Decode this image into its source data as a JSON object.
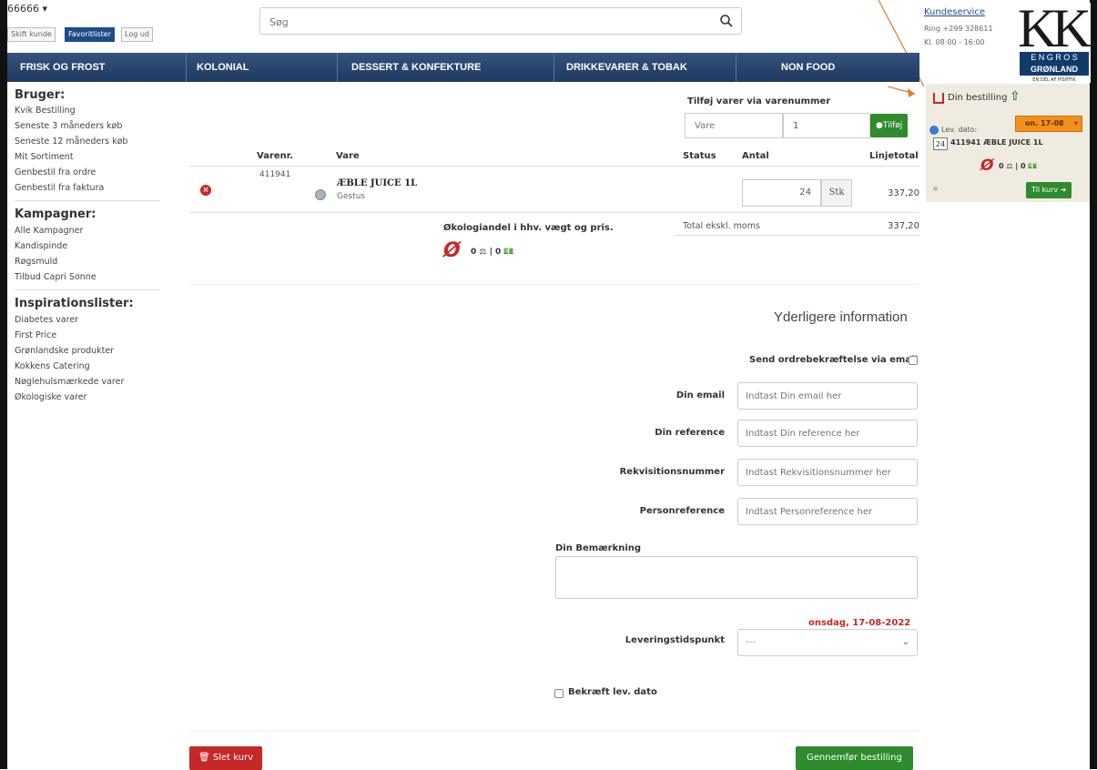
{
  "header": {
    "account": "66666 ▾",
    "btn_shift": "Skift kunde",
    "btn_fav": "Favoritlister",
    "btn_logout": "Log ud",
    "search_placeholder": "Søg",
    "kundeservice": "Kundeservice",
    "phone": "Ring +299 328611",
    "hours": "Kl. 08:00 - 16:00"
  },
  "logo": {
    "kk": "KK",
    "line1": "E N G R O S",
    "line2": "GRØNLAND",
    "sub": "EN DEL AF PISIFFIK"
  },
  "nav": [
    "FRISK OG FROST",
    "KOLONIAL",
    "DESSERT & KONFEKTURE",
    "DRIKKEVARER & TOBAK",
    "NON FOOD"
  ],
  "sidebar": {
    "bruger_title": "Bruger:",
    "bruger": [
      "Kvik Bestilling",
      "Seneste 3 måneders køb",
      "Seneste 12 måneders køb",
      "Mit Sortiment",
      "Genbestil fra ordre",
      "Genbestil fra faktura"
    ],
    "kampagner_title": "Kampagner:",
    "kampagner": [
      "Alle Kampagner",
      "Kandispinde",
      "Røgsmuld",
      "Tilbud Capri Sonne"
    ],
    "insp_title": "Inspirationslister:",
    "insp": [
      "Diabetes varer",
      "First Price",
      "Grønlandske produkter",
      "Kokkens Catering",
      "Nøglehulsmærkede varer",
      "Økologiske varer"
    ]
  },
  "add_item": {
    "title": "Tilføj varer via varenummer",
    "placeholder": "Vare",
    "qty": "1",
    "button": "Tilføj"
  },
  "table": {
    "headers": {
      "varenr": "Varenr.",
      "vare": "Vare",
      "status": "Status",
      "antal": "Antal",
      "linjetotal": "Linjetotal"
    },
    "row": {
      "varenr": "411941",
      "name": "ÆBLE JUICE 1L",
      "brand": "Gestus",
      "qty": "24",
      "unit": "Stk",
      "total": "337,20"
    },
    "eco_label": "Økologiandel i hhv. vægt og pris.",
    "eco_values": "0 ⚖ | 0 💵",
    "total_label": "Total ekskl. moms",
    "total_value": "337,20"
  },
  "form": {
    "title": "Yderligere information",
    "send_email": "Send ordrebekræftelse via email",
    "email_label": "Din email",
    "email_ph": "Indtast Din email her",
    "ref_label": "Din reference",
    "ref_ph": "Indtast Din reference her",
    "rek_label": "Rekvisitionsnummer",
    "rek_ph": "Indtast Rekvisitionsnummer her",
    "person_label": "Personreference",
    "person_ph": "Indtast Personreference her",
    "remark_label": "Din Bemærkning",
    "date": "onsdag, 17-08-2022",
    "lev_label": "Leveringstidspunkt",
    "lev_value": "---",
    "confirm": "Bekræft lev. dato"
  },
  "buttons": {
    "delete_cart": "Slet kurv",
    "complete": "Gennemfør bestilling"
  },
  "panel": {
    "title": "Din bestilling",
    "lev_dato": "Lev. dato:",
    "date_value": "on. 17-08",
    "item_qty": "24",
    "item_text": "411941 ÆBLE JUICE 1L",
    "eco_values": "0 ⚖ | 0 💵",
    "to_cart": "Til kurv"
  },
  "colors": {
    "nav": "#203a60",
    "red": "#c62828",
    "green": "#2e8b2e",
    "orange": "#f0901e",
    "panel": "#efebe0"
  }
}
